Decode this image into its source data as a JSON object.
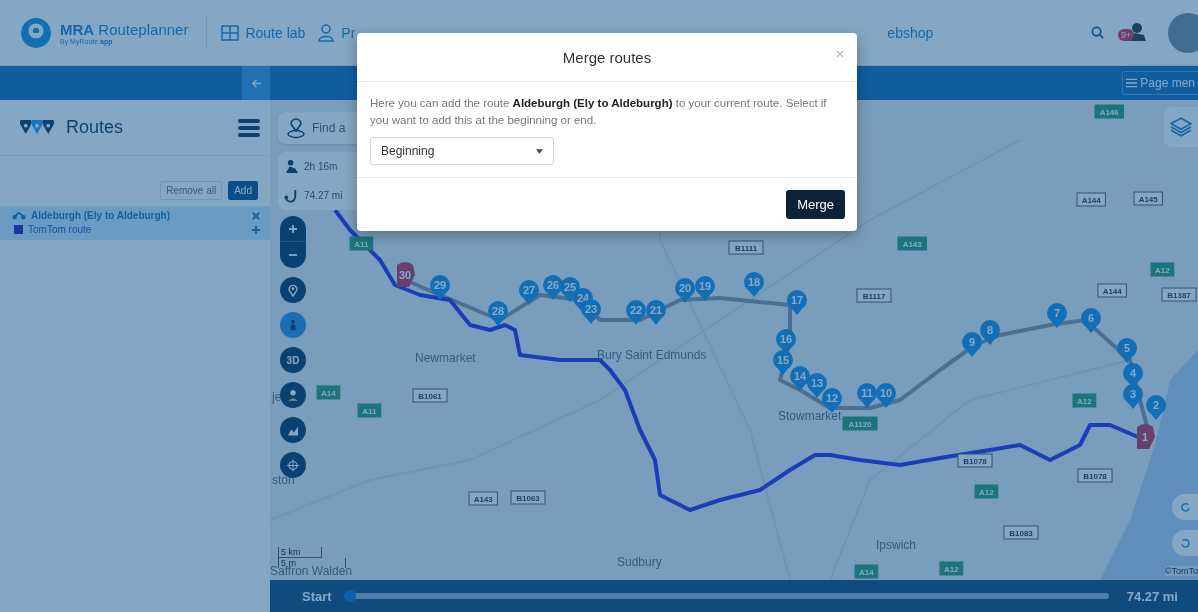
{
  "header": {
    "logo_title": "**MRA** Routeplanner",
    "logo_subtitle": "By MyRoute **app**",
    "nav": [
      {
        "label": "Route lab",
        "kind": "grid"
      },
      {
        "label": "Pr",
        "kind": "person"
      },
      {
        "label": "ebshop",
        "kind": "plain"
      }
    ],
    "notification_badge": "9+"
  },
  "subbar": {
    "page_menu": "Page men"
  },
  "sidebar": {
    "title": "Routes",
    "buttons": [
      "Remove all",
      "Add"
    ],
    "routes": [
      {
        "name": "Aldeburgh (Ely to Aldeburgh)",
        "sub": "TomTom route",
        "selected": true
      }
    ]
  },
  "map": {
    "search_placeholder": "Find a",
    "duration": "2h 16m",
    "distance": "74.27 mi",
    "tool_3d": "3D",
    "waypoints": [
      {
        "label": "30",
        "kind": "hand"
      },
      {
        "label": "29",
        "kind": "pin"
      },
      {
        "label": "28",
        "kind": "pin"
      },
      {
        "label": "27",
        "kind": "pin"
      },
      {
        "label": "26",
        "kind": "pin"
      },
      {
        "label": "25",
        "kind": "pin"
      },
      {
        "label": "24",
        "kind": "pin"
      },
      {
        "label": "23",
        "kind": "pin"
      },
      {
        "label": "22",
        "kind": "pin"
      },
      {
        "label": "21",
        "kind": "pin"
      },
      {
        "label": "20",
        "kind": "pin"
      },
      {
        "label": "19",
        "kind": "pin"
      },
      {
        "label": "18",
        "kind": "pin"
      },
      {
        "label": "17",
        "kind": "pin"
      },
      {
        "label": "16",
        "kind": "pin"
      },
      {
        "label": "15",
        "kind": "pin"
      },
      {
        "label": "14",
        "kind": "pin"
      },
      {
        "label": "13",
        "kind": "pin"
      },
      {
        "label": "12",
        "kind": "pin"
      },
      {
        "label": "11",
        "kind": "pin"
      },
      {
        "label": "10",
        "kind": "pin"
      },
      {
        "label": "9",
        "kind": "pin"
      },
      {
        "label": "8",
        "kind": "pin"
      },
      {
        "label": "7",
        "kind": "pin"
      },
      {
        "label": "6",
        "kind": "pin"
      },
      {
        "label": "5",
        "kind": "pin"
      },
      {
        "label": "4",
        "kind": "pin"
      },
      {
        "label": "3",
        "kind": "pin"
      },
      {
        "label": "2",
        "kind": "pin"
      },
      {
        "label": "1",
        "kind": "hand"
      }
    ],
    "places": [
      "Newmarket",
      "Bury Saint Edmunds",
      "je",
      "Stowmarket",
      "ston",
      "Ipswich",
      "Sudbury",
      "Saffron Walden"
    ],
    "roads": [
      {
        "label": "A14",
        "kind": "primary"
      },
      {
        "label": "A11",
        "kind": "primary"
      },
      {
        "label": "A11",
        "kind": "primary"
      },
      {
        "label": "B1061",
        "kind": "secondary"
      },
      {
        "label": "A143",
        "kind": "secondary"
      },
      {
        "label": "B1063",
        "kind": "secondary"
      },
      {
        "label": "B1111",
        "kind": "secondary"
      },
      {
        "label": "A1120",
        "kind": "primary"
      },
      {
        "label": "B1117",
        "kind": "secondary"
      },
      {
        "label": "A143",
        "kind": "primary"
      },
      {
        "label": "A144",
        "kind": "secondary"
      },
      {
        "label": "A145",
        "kind": "secondary"
      },
      {
        "label": "A146",
        "kind": "primary"
      },
      {
        "label": "A12",
        "kind": "primary"
      },
      {
        "label": "A144",
        "kind": "secondary"
      },
      {
        "label": "B1387",
        "kind": "secondary"
      },
      {
        "label": "A12",
        "kind": "primary"
      },
      {
        "label": "B1078",
        "kind": "secondary"
      },
      {
        "label": "B1078",
        "kind": "secondary"
      },
      {
        "label": "A12",
        "kind": "primary"
      },
      {
        "label": "B1083",
        "kind": "secondary"
      },
      {
        "label": "A14",
        "kind": "primary"
      },
      {
        "label": "A12",
        "kind": "primary"
      }
    ],
    "scale": [
      "5 km",
      "5 m"
    ],
    "attribution": "©TomTo"
  },
  "timeline": {
    "start": "Start",
    "level": 0.0,
    "end": "74.27 mi"
  },
  "modal": {
    "title": "Merge routes",
    "message": "Here you can add the route **Aldeburgh (Ely to Aldeburgh)** to your current route. Select if you want to add this at the beginning or end.",
    "select": "Beginning",
    "button": "Merge"
  }
}
